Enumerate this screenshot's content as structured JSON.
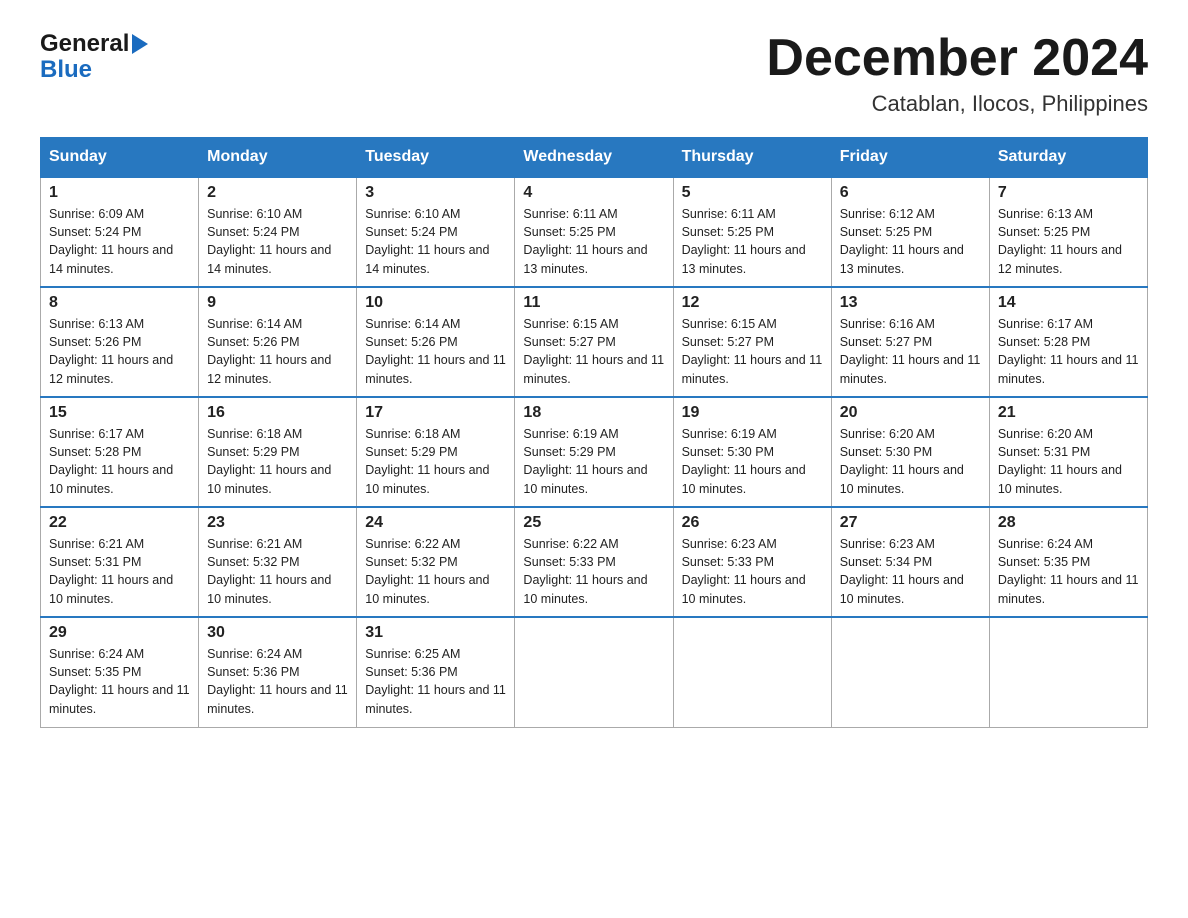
{
  "header": {
    "logo_general": "General",
    "logo_blue": "Blue",
    "month_title": "December 2024",
    "location": "Catablan, Ilocos, Philippines"
  },
  "days_of_week": [
    "Sunday",
    "Monday",
    "Tuesday",
    "Wednesday",
    "Thursday",
    "Friday",
    "Saturday"
  ],
  "weeks": [
    [
      {
        "date": "1",
        "sunrise": "6:09 AM",
        "sunset": "5:24 PM",
        "daylight": "11 hours and 14 minutes."
      },
      {
        "date": "2",
        "sunrise": "6:10 AM",
        "sunset": "5:24 PM",
        "daylight": "11 hours and 14 minutes."
      },
      {
        "date": "3",
        "sunrise": "6:10 AM",
        "sunset": "5:24 PM",
        "daylight": "11 hours and 14 minutes."
      },
      {
        "date": "4",
        "sunrise": "6:11 AM",
        "sunset": "5:25 PM",
        "daylight": "11 hours and 13 minutes."
      },
      {
        "date": "5",
        "sunrise": "6:11 AM",
        "sunset": "5:25 PM",
        "daylight": "11 hours and 13 minutes."
      },
      {
        "date": "6",
        "sunrise": "6:12 AM",
        "sunset": "5:25 PM",
        "daylight": "11 hours and 13 minutes."
      },
      {
        "date": "7",
        "sunrise": "6:13 AM",
        "sunset": "5:25 PM",
        "daylight": "11 hours and 12 minutes."
      }
    ],
    [
      {
        "date": "8",
        "sunrise": "6:13 AM",
        "sunset": "5:26 PM",
        "daylight": "11 hours and 12 minutes."
      },
      {
        "date": "9",
        "sunrise": "6:14 AM",
        "sunset": "5:26 PM",
        "daylight": "11 hours and 12 minutes."
      },
      {
        "date": "10",
        "sunrise": "6:14 AM",
        "sunset": "5:26 PM",
        "daylight": "11 hours and 11 minutes."
      },
      {
        "date": "11",
        "sunrise": "6:15 AM",
        "sunset": "5:27 PM",
        "daylight": "11 hours and 11 minutes."
      },
      {
        "date": "12",
        "sunrise": "6:15 AM",
        "sunset": "5:27 PM",
        "daylight": "11 hours and 11 minutes."
      },
      {
        "date": "13",
        "sunrise": "6:16 AM",
        "sunset": "5:27 PM",
        "daylight": "11 hours and 11 minutes."
      },
      {
        "date": "14",
        "sunrise": "6:17 AM",
        "sunset": "5:28 PM",
        "daylight": "11 hours and 11 minutes."
      }
    ],
    [
      {
        "date": "15",
        "sunrise": "6:17 AM",
        "sunset": "5:28 PM",
        "daylight": "11 hours and 10 minutes."
      },
      {
        "date": "16",
        "sunrise": "6:18 AM",
        "sunset": "5:29 PM",
        "daylight": "11 hours and 10 minutes."
      },
      {
        "date": "17",
        "sunrise": "6:18 AM",
        "sunset": "5:29 PM",
        "daylight": "11 hours and 10 minutes."
      },
      {
        "date": "18",
        "sunrise": "6:19 AM",
        "sunset": "5:29 PM",
        "daylight": "11 hours and 10 minutes."
      },
      {
        "date": "19",
        "sunrise": "6:19 AM",
        "sunset": "5:30 PM",
        "daylight": "11 hours and 10 minutes."
      },
      {
        "date": "20",
        "sunrise": "6:20 AM",
        "sunset": "5:30 PM",
        "daylight": "11 hours and 10 minutes."
      },
      {
        "date": "21",
        "sunrise": "6:20 AM",
        "sunset": "5:31 PM",
        "daylight": "11 hours and 10 minutes."
      }
    ],
    [
      {
        "date": "22",
        "sunrise": "6:21 AM",
        "sunset": "5:31 PM",
        "daylight": "11 hours and 10 minutes."
      },
      {
        "date": "23",
        "sunrise": "6:21 AM",
        "sunset": "5:32 PM",
        "daylight": "11 hours and 10 minutes."
      },
      {
        "date": "24",
        "sunrise": "6:22 AM",
        "sunset": "5:32 PM",
        "daylight": "11 hours and 10 minutes."
      },
      {
        "date": "25",
        "sunrise": "6:22 AM",
        "sunset": "5:33 PM",
        "daylight": "11 hours and 10 minutes."
      },
      {
        "date": "26",
        "sunrise": "6:23 AM",
        "sunset": "5:33 PM",
        "daylight": "11 hours and 10 minutes."
      },
      {
        "date": "27",
        "sunrise": "6:23 AM",
        "sunset": "5:34 PM",
        "daylight": "11 hours and 10 minutes."
      },
      {
        "date": "28",
        "sunrise": "6:24 AM",
        "sunset": "5:35 PM",
        "daylight": "11 hours and 11 minutes."
      }
    ],
    [
      {
        "date": "29",
        "sunrise": "6:24 AM",
        "sunset": "5:35 PM",
        "daylight": "11 hours and 11 minutes."
      },
      {
        "date": "30",
        "sunrise": "6:24 AM",
        "sunset": "5:36 PM",
        "daylight": "11 hours and 11 minutes."
      },
      {
        "date": "31",
        "sunrise": "6:25 AM",
        "sunset": "5:36 PM",
        "daylight": "11 hours and 11 minutes."
      },
      null,
      null,
      null,
      null
    ]
  ],
  "colors": {
    "header_bg": "#2878c0",
    "border": "#aaa",
    "row_top_border": "#2878c0"
  }
}
